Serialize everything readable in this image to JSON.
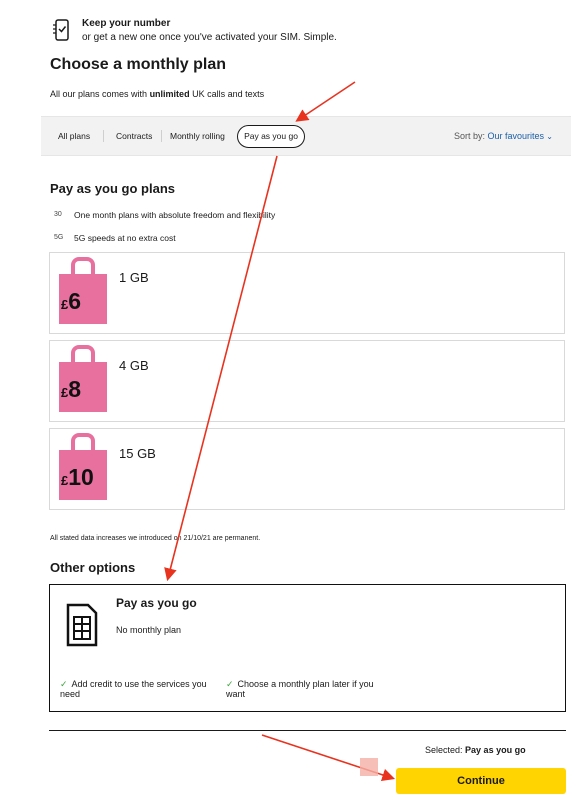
{
  "keep": {
    "title": "Keep your number",
    "subtitle": "or get a new one once you've activated your SIM. Simple.",
    "icon": "phone-check-icon"
  },
  "plans": {
    "heading": "Choose a monthly plan",
    "sub_before": "All our plans comes with",
    "sub_bold": "unlimited",
    "sub_after": "UK calls and texts"
  },
  "filters": {
    "items": [
      "All plans",
      "Contracts",
      "Monthly rolling"
    ],
    "active": "Pay as you go",
    "sort_label": "Sort by:",
    "sort_value": "Our favourites"
  },
  "payg": {
    "heading": "Pay as you go plans",
    "features": [
      {
        "icon": "30",
        "text": "One month plans with absolute freedom and flexibility"
      },
      {
        "icon": "5G",
        "text": "5G speeds at no extra cost"
      }
    ],
    "cards": [
      {
        "currency": "£",
        "price": "6",
        "data": "1 GB"
      },
      {
        "currency": "£",
        "price": "8",
        "data": "4 GB"
      },
      {
        "currency": "£",
        "price": "10",
        "data": "15 GB"
      }
    ],
    "note": "All stated data increases we introduced on 21/10/21 are permanent."
  },
  "other": {
    "heading": "Other options",
    "title": "Pay as you go",
    "subtitle": "No monthly plan",
    "check1": "Add credit to use the services you need",
    "check2": "Choose a monthly plan later if you want"
  },
  "footer": {
    "selected_label": "Selected:",
    "selected_value": "Pay as you go",
    "continue": "Continue"
  },
  "colors": {
    "accent_pink": "#e8709e",
    "cta_yellow": "#ffd400",
    "link_blue": "#1b5fa8",
    "tick_green": "#3ba53b",
    "annotation_red": "#e8331f"
  }
}
